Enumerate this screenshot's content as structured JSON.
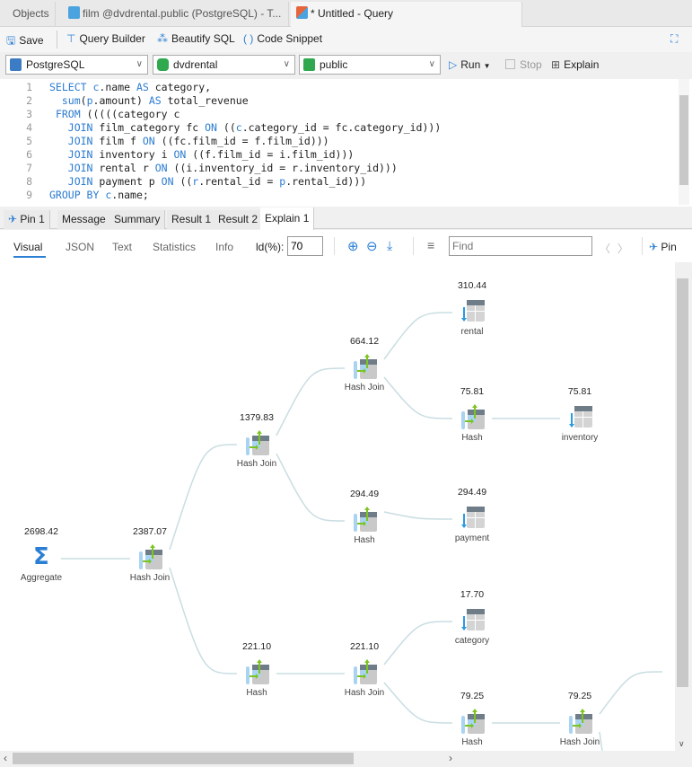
{
  "tabs": [
    {
      "label": "Objects"
    },
    {
      "label": "film @dvdrental.public (PostgreSQL) - T..."
    },
    {
      "label": "* Untitled - Query"
    }
  ],
  "toolbar": {
    "save": "Save",
    "query_builder": "Query Builder",
    "beautify": "Beautify SQL",
    "snippet": "Code Snippet"
  },
  "selectors": {
    "connection": "PostgreSQL",
    "database": "dvdrental",
    "schema": "public"
  },
  "actions": {
    "run": "Run",
    "stop": "Stop",
    "explain": "Explain"
  },
  "editor": {
    "lines": [
      {
        "n": "1",
        "html": "<span class='kw'>SELECT</span> <span class='kw'>c</span>.name <span class='kw'>AS</span> category,"
      },
      {
        "n": "2",
        "html": "  <span class='kw'>sum</span>(<span class='kw'>p</span>.amount) <span class='kw'>AS</span> total_revenue"
      },
      {
        "n": "3",
        "html": " <span class='kw'>FROM</span> (((((category c"
      },
      {
        "n": "4",
        "html": "   <span class='kw'>JOIN</span> film_category fc <span class='kw'>ON</span> ((<span class='kw'>c</span>.category_id = fc.category_id)))"
      },
      {
        "n": "5",
        "html": "   <span class='kw'>JOIN</span> film f <span class='kw'>ON</span> ((fc.film_id = f.film_id)))"
      },
      {
        "n": "6",
        "html": "   <span class='kw'>JOIN</span> inventory i <span class='kw'>ON</span> ((f.film_id = i.film_id)))"
      },
      {
        "n": "7",
        "html": "   <span class='kw'>JOIN</span> rental r <span class='kw'>ON</span> ((i.inventory_id = r.inventory_id)))"
      },
      {
        "n": "8",
        "html": "   <span class='kw'>JOIN</span> payment p <span class='kw'>ON</span> ((<span class='kw'>r</span>.rental_id = <span class='kw'>p</span>.rental_id)))"
      },
      {
        "n": "9",
        "html": "<span class='kw'>GROUP BY</span> <span class='kw'>c</span>.name;"
      }
    ]
  },
  "result_tabs": [
    {
      "label": "Pin 1"
    },
    {
      "label": "Message"
    },
    {
      "label": "Summary"
    },
    {
      "label": "Result 1"
    },
    {
      "label": "Result 2"
    },
    {
      "label": "Explain 1"
    }
  ],
  "view_tabs": [
    {
      "label": "Visual"
    },
    {
      "label": "JSON"
    },
    {
      "label": "Text"
    },
    {
      "label": "Statistics"
    },
    {
      "label": "Info"
    }
  ],
  "ld_label": "ld(%):",
  "ld_value": "70",
  "find_placeholder": "Find",
  "pin_label": "Pin",
  "plan_nodes": [
    {
      "id": "agg",
      "type": "aggregate",
      "cost": "2698.42",
      "label": "Aggregate"
    },
    {
      "id": "hj1",
      "type": "join",
      "cost": "2387.07",
      "label": "Hash Join"
    },
    {
      "id": "hj2",
      "type": "join",
      "cost": "1379.83",
      "label": "Hash Join"
    },
    {
      "id": "hj3",
      "type": "join",
      "cost": "664.12",
      "label": "Hash Join"
    },
    {
      "id": "rental",
      "type": "table",
      "cost": "310.44",
      "label": "rental"
    },
    {
      "id": "h1",
      "type": "join",
      "cost": "75.81",
      "label": "Hash"
    },
    {
      "id": "inventory",
      "type": "table",
      "cost": "75.81",
      "label": "inventory"
    },
    {
      "id": "h2",
      "type": "join",
      "cost": "294.49",
      "label": "Hash"
    },
    {
      "id": "payment",
      "type": "table",
      "cost": "294.49",
      "label": "payment"
    },
    {
      "id": "h3",
      "type": "join",
      "cost": "221.10",
      "label": "Hash"
    },
    {
      "id": "hj4",
      "type": "join",
      "cost": "221.10",
      "label": "Hash Join"
    },
    {
      "id": "category",
      "type": "table",
      "cost": "17.70",
      "label": "category"
    },
    {
      "id": "h4",
      "type": "join",
      "cost": "79.25",
      "label": "Hash"
    },
    {
      "id": "hj5",
      "type": "join",
      "cost": "79.25",
      "label": "Hash Join"
    }
  ],
  "plan_edges": [
    [
      "agg",
      "hj1"
    ],
    [
      "hj1",
      "hj2"
    ],
    [
      "hj2",
      "hj3"
    ],
    [
      "hj3",
      "rental"
    ],
    [
      "hj3",
      "h1"
    ],
    [
      "h1",
      "inventory"
    ],
    [
      "hj2",
      "h2"
    ],
    [
      "h2",
      "payment"
    ],
    [
      "hj1",
      "h3"
    ],
    [
      "h3",
      "hj4"
    ],
    [
      "hj4",
      "category"
    ],
    [
      "hj4",
      "h4"
    ],
    [
      "h4",
      "hj5"
    ]
  ],
  "colors": {
    "accent": "#2a7fd4",
    "join_arrow": "#7cc520",
    "edge": "#c9dde2"
  }
}
